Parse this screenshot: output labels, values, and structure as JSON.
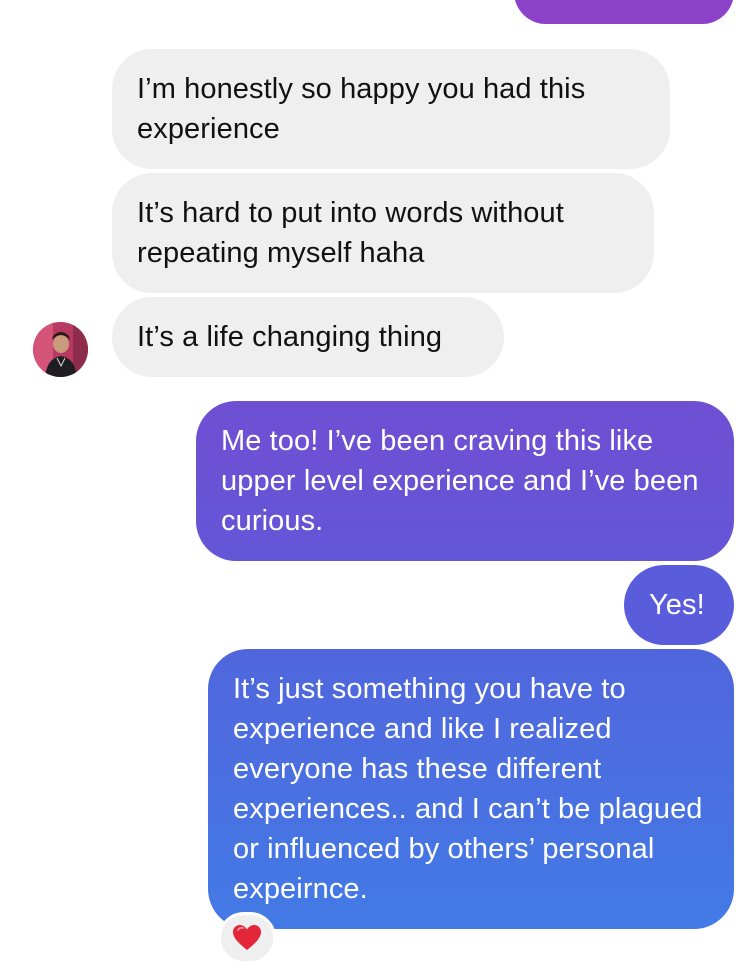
{
  "messages": {
    "received": [
      "I’m honestly so happy you had this experience",
      "It’s hard to put into words without repeating myself haha",
      "It’s a life changing thing"
    ],
    "sent": [
      "Me too! I’ve been craving this like upper level experience and I’ve been curious.",
      "Yes!",
      "It’s just something you have to experience and like I realized everyone has these different experiences.. and I can’t be plagued or influenced by others’ personal expeirnce."
    ]
  },
  "reaction": {
    "emoji": "❤️",
    "icon": "heart-icon"
  },
  "colors": {
    "incoming_bubble": "#efefef",
    "outgoing_gradient_top": "#8a45cc",
    "outgoing_gradient_bottom": "#3f7fe6"
  }
}
